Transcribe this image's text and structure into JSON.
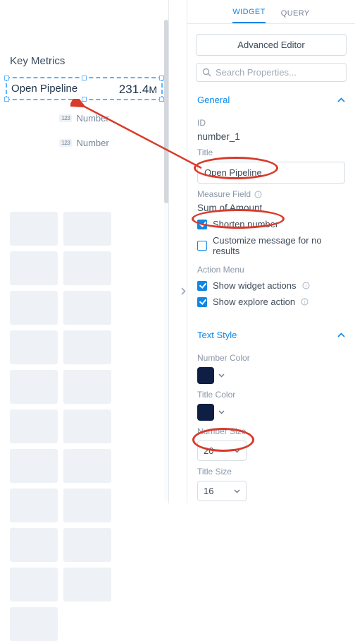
{
  "canvas": {
    "card_title": "Key Metrics",
    "selected_widget": {
      "title": "Open Pipeline",
      "value": "231.4",
      "unit": "M"
    },
    "placeholders": [
      "Number",
      "Number"
    ],
    "placeholder_icon_text": "123"
  },
  "tabs": {
    "widget": "WIDGET",
    "query": "QUERY"
  },
  "advanced_button": "Advanced Editor",
  "search": {
    "placeholder": "Search Properties..."
  },
  "sections": {
    "general": {
      "title": "General",
      "id_label": "ID",
      "id_value": "number_1",
      "title_label": "Title",
      "title_value": "Open Pipeline",
      "measure_label": "Measure Field",
      "measure_value": "Sum of Amount",
      "shorten_label": "Shorten number",
      "custom_msg_label": "Customize message for no results",
      "action_menu_label": "Action Menu",
      "show_widget_actions": "Show widget actions",
      "show_explore_action": "Show explore action"
    },
    "text_style": {
      "title": "Text Style",
      "number_color_label": "Number Color",
      "title_color_label": "Title Color",
      "number_size_label": "Number Size",
      "number_size_value": "20",
      "title_size_label": "Title Size",
      "title_size_value": "16",
      "color_number": "#0f1f44",
      "color_title": "#0f1f44"
    }
  }
}
